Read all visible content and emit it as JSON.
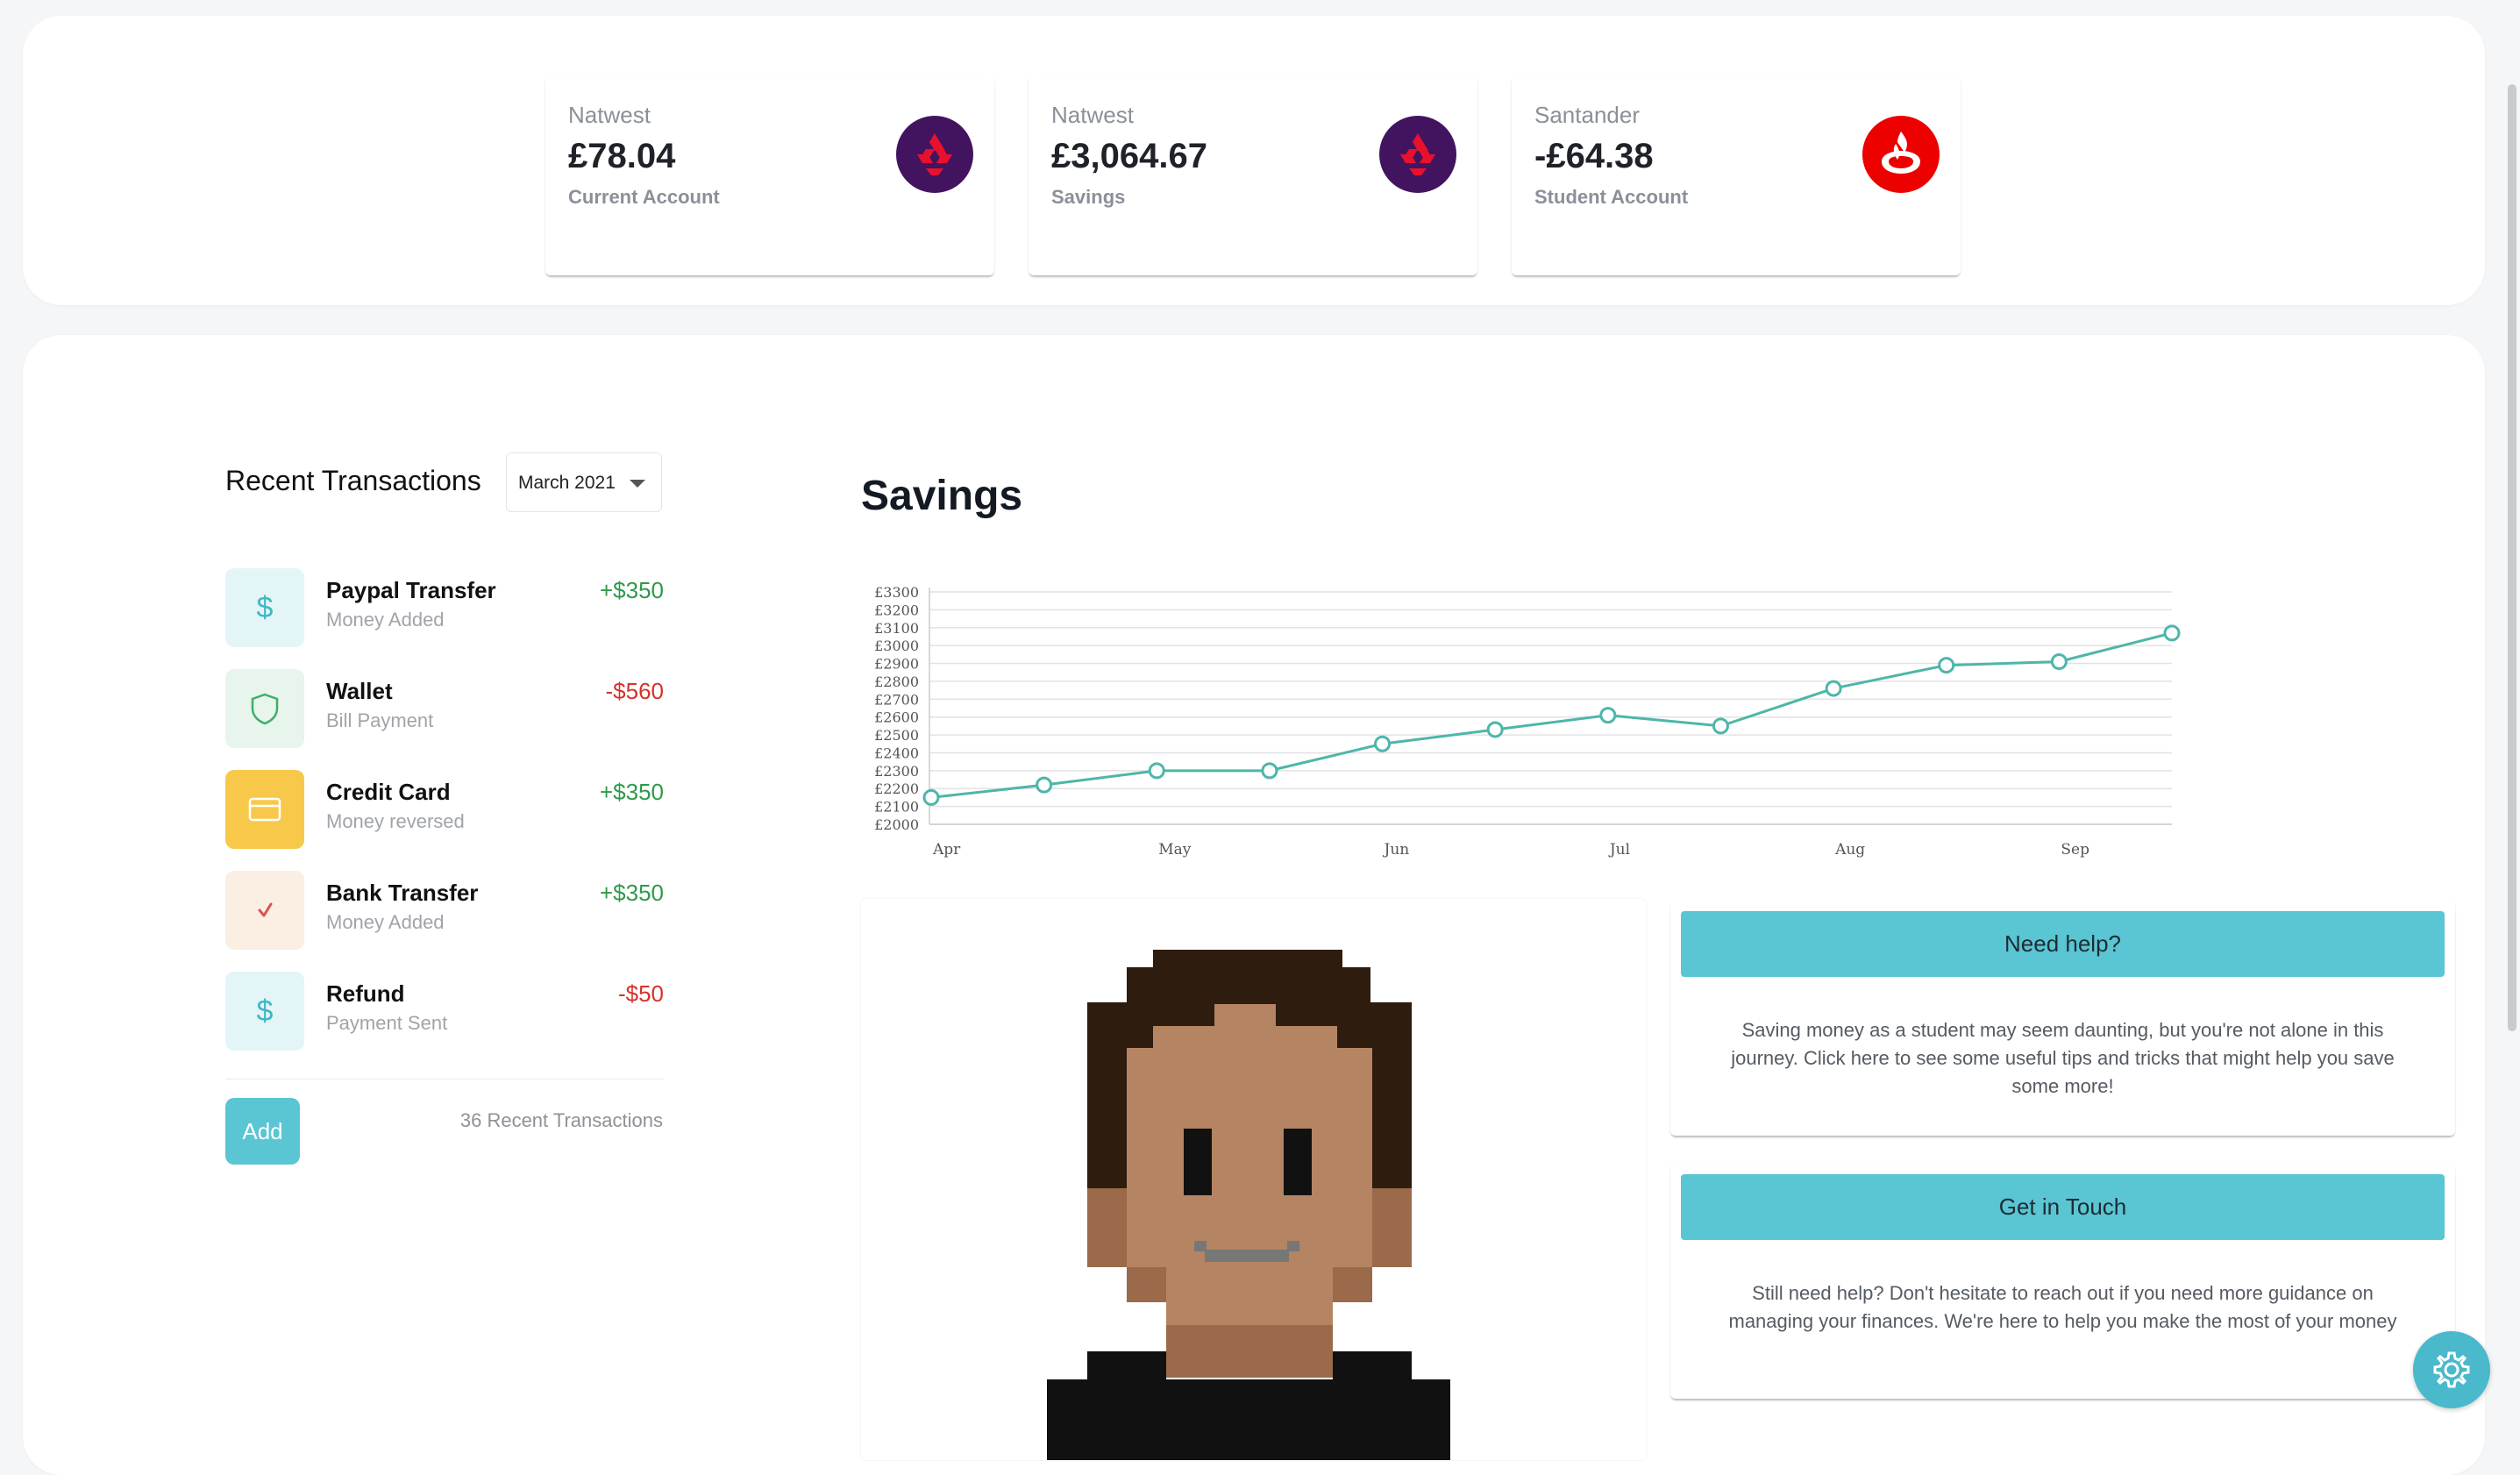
{
  "accounts": [
    {
      "bank": "Natwest",
      "amount": "£78.04",
      "type": "Current Account",
      "logo": "natwest-logo"
    },
    {
      "bank": "Natwest",
      "amount": "£3,064.67",
      "type": "Savings",
      "logo": "natwest-logo"
    },
    {
      "bank": "Santander",
      "amount": "-£64.38",
      "type": "Student Account",
      "logo": "santander-logo"
    }
  ],
  "transactions": {
    "title": "Recent Transactions",
    "month_select": "March 2021",
    "items": [
      {
        "name": "Paypal Transfer",
        "sub": "Money Added",
        "amount": "+$350",
        "icon": "dollar-icon"
      },
      {
        "name": "Wallet",
        "sub": "Bill Payment",
        "amount": "-$560",
        "icon": "shield-icon"
      },
      {
        "name": "Credit Card",
        "sub": "Money reversed",
        "amount": "+$350",
        "icon": "credit-card-icon"
      },
      {
        "name": "Bank Transfer",
        "sub": "Money Added",
        "amount": "+$350",
        "icon": "check-icon"
      },
      {
        "name": "Refund",
        "sub": "Payment Sent",
        "amount": "-$50",
        "icon": "dollar-icon"
      }
    ],
    "add_label": "Add",
    "count_label": "36 Recent Transactions"
  },
  "savings": {
    "title": "Savings"
  },
  "chart_data": {
    "type": "line",
    "x": [
      "Apr",
      "Apr (mid)",
      "May",
      "May (mid)",
      "Jun",
      "Jun (mid)",
      "Jul",
      "Jul (mid)",
      "Aug",
      "Aug (mid)",
      "Sep",
      "Sep (mid)"
    ],
    "x_tick_labels": [
      "Apr",
      "May",
      "Jun",
      "Jul",
      "Aug",
      "Sep"
    ],
    "values": [
      2150,
      2220,
      2300,
      2300,
      2450,
      2530,
      2610,
      2550,
      2760,
      2890,
      2910,
      3070
    ],
    "y_tick_labels": [
      "£3300",
      "£3200",
      "£3100",
      "£3000",
      "£2900",
      "£2800",
      "£2700",
      "£2600",
      "£2500",
      "£2400",
      "£2300",
      "£2200",
      "£2100",
      "£2000"
    ],
    "ylim": [
      2000,
      3300
    ],
    "grid": true,
    "color": "#4db6a9",
    "title": "",
    "xlabel": "",
    "ylabel": ""
  },
  "help": [
    {
      "button": "Need help?",
      "text": "Saving money as a student may seem daunting, but you're not alone in this journey. Click here to see some useful tips and tricks that might help you save some more!"
    },
    {
      "button": "Get in Touch",
      "text": "Still need help? Don't hesitate to reach out if you need more guidance on managing your finances. We're here to help you make the most of your money"
    }
  ],
  "colors": {
    "accent": "#5ac5d3",
    "positive": "#2e9a4a",
    "negative": "#d6322c",
    "natwest": "#42145f",
    "santander": "#ec0000"
  }
}
